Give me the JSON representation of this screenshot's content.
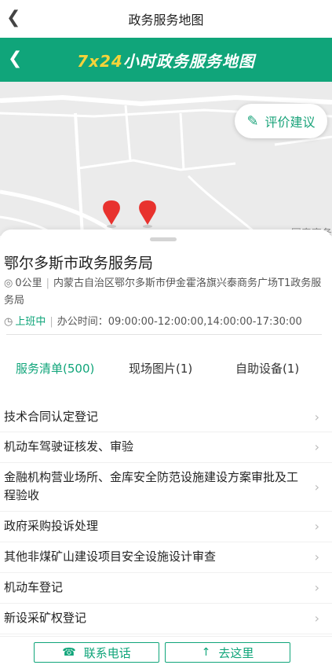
{
  "header": {
    "title": "政务服务地图",
    "back_icon": "chevron-left-icon"
  },
  "banner": {
    "title_highlight": "7x24",
    "title_rest": "小时政务服务地图"
  },
  "map": {
    "eval_button_label": "评价建议",
    "poi_label": "国泰商务",
    "markers": 2
  },
  "detail": {
    "name": "鄂尔多斯市政务服务局",
    "distance": "0公里",
    "address": "内蒙古自治区鄂尔多斯市伊金霍洛旗兴泰商务广场T1政务服务局",
    "status": "上班中",
    "hours": "办公时间：09:00:00-12:00:00,14:00:00-17:30:00"
  },
  "tabs": [
    {
      "label": "服务清单(500)",
      "active": true
    },
    {
      "label": "现场图片(1)",
      "active": false
    },
    {
      "label": "自助设备(1)",
      "active": false
    }
  ],
  "services": [
    "技术合同认定登记",
    "机动车驾驶证核发、审验",
    "金融机构营业场所、金库安全防范设施建设方案审批及工程验收",
    "政府采购投诉处理",
    "其他非煤矿山建设项目安全设施设计审查",
    "机动车登记",
    "新设采矿权登记"
  ],
  "actions": {
    "call_label": "联系电话",
    "go_label": "去这里"
  },
  "colors": {
    "primary": "#10a57a",
    "accent": "#f5d33a",
    "marker": "#e8322e"
  }
}
